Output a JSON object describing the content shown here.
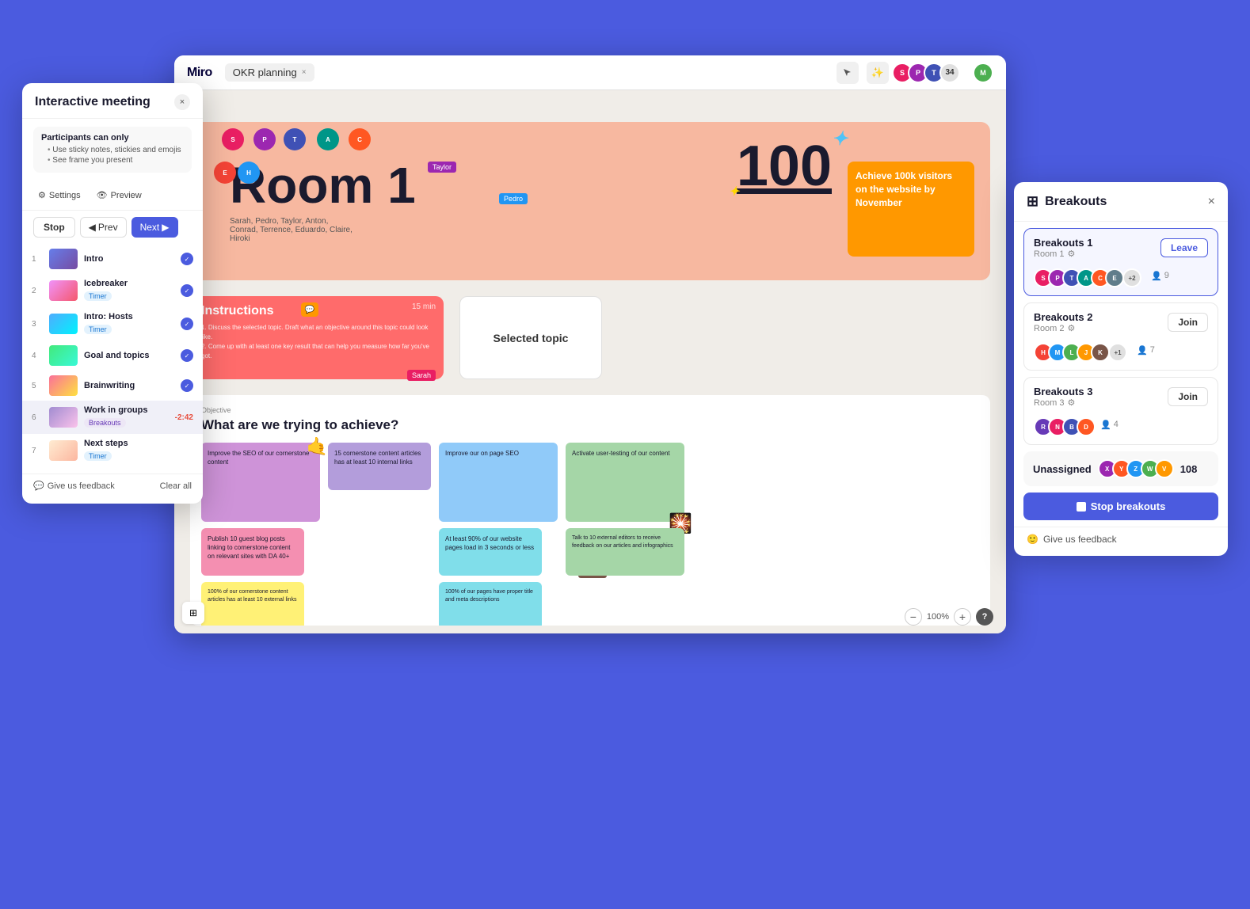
{
  "app": {
    "title": "Miro",
    "tab_label": "OKR planning",
    "canvas_room_label": "Room 1"
  },
  "header": {
    "avatars": [
      {
        "color": "c1",
        "initials": "S"
      },
      {
        "color": "c2",
        "initials": "P"
      },
      {
        "color": "c3",
        "initials": "T"
      }
    ],
    "participant_count": "34"
  },
  "left_panel": {
    "title": "Interactive meeting",
    "participants_box_title": "Participants can only",
    "participants_rules": [
      "Use sticky notes, stickies and emojis",
      "See frame you present"
    ],
    "settings_label": "Settings",
    "preview_label": "Preview",
    "stop_label": "Stop",
    "prev_label": "Prev",
    "next_label": "Next",
    "agenda_items": [
      {
        "num": "1",
        "label": "Intro",
        "has_check": true
      },
      {
        "num": "2",
        "label": "Icebreaker",
        "has_check": true,
        "badge": "Timer",
        "badge_type": "timer"
      },
      {
        "num": "3",
        "label": "Intro: Hosts",
        "has_check": true,
        "badge": "Timer",
        "badge_type": "timer"
      },
      {
        "num": "4",
        "label": "Goal and topics",
        "has_check": true
      },
      {
        "num": "5",
        "label": "Brainwriting",
        "has_check": true
      },
      {
        "num": "6",
        "label": "Work in groups",
        "time": "-2:42",
        "badge": "Breakouts",
        "badge_type": "breakout"
      },
      {
        "num": "7",
        "label": "Next steps",
        "badge": "Timer",
        "badge_type": "timer"
      }
    ],
    "feedback_label": "Give us feedback",
    "clear_label": "Clear all"
  },
  "canvas": {
    "room1_title": "Room 1",
    "room1_subtitle": "Sarah, Pedro, Taylor, Anton, Conrad, Terrence, Eduardo, Claire, Hiroki",
    "goal_card_text": "Achieve 100k visitors on the website by November",
    "number_100": "100",
    "instructions_title": "Instructions",
    "instructions_timer": "15 min",
    "instructions_text": "1. Discuss the selected topic. Draft what an objective around this topic could look like.\n2. Come up with at least one key result that can help you measure how far you've got.",
    "selected_topic_label": "Selected topic",
    "objective_label": "Objective",
    "objective_title": "What are we trying to achieve?",
    "sticky_notes": [
      {
        "color": "purple",
        "text": "Improve the SEO of our cornerstone content"
      },
      {
        "color": "blue",
        "text": "Improve our on page SEO"
      },
      {
        "color": "green",
        "text": "Activate user-testing of our content"
      },
      {
        "color": "pink",
        "text": "Publish 10 guest blog posts linking to cornerstone content on relevant sites with DA 40+"
      },
      {
        "color": "light-purple",
        "text": "15 cornerstone content articles has at least 10 internal links"
      },
      {
        "color": "light-blue",
        "text": "100% of our pages have proper title and meta descriptions"
      },
      {
        "color": "green",
        "text": "Talk to 10 external editors to receive feedback on our articles and infographics"
      },
      {
        "color": "yellow",
        "text": "100% of our cornerstone content articles has at least 10 external links"
      }
    ],
    "cursors": [
      {
        "name": "Sarah",
        "color": "#e91e63"
      },
      {
        "name": "Pedro",
        "color": "#3f51b5"
      },
      {
        "name": "Taylor",
        "color": "#9c27b0"
      },
      {
        "name": "Eduardo",
        "color": "#4CAF50"
      },
      {
        "name": "Anton",
        "color": "#FF5722"
      },
      {
        "name": "Conrad",
        "color": "#009688"
      },
      {
        "name": "Claire",
        "color": "#795548"
      },
      {
        "name": "Hiroki",
        "color": "#607D8B"
      },
      {
        "name": "Terrence",
        "color": "#333"
      }
    ],
    "zoom_level": "100%"
  },
  "breakouts_panel": {
    "title": "Breakouts",
    "rooms": [
      {
        "name": "Breakouts 1",
        "sub": "Room 1",
        "action": "Leave",
        "is_active": true,
        "count": 9,
        "avatars": [
          "c1",
          "c2",
          "c3",
          "c4",
          "c5",
          "c6"
        ]
      },
      {
        "name": "Breakouts 2",
        "sub": "Room 2",
        "action": "Join",
        "is_active": false,
        "count": 7,
        "avatars": [
          "c7",
          "c8",
          "c9",
          "ca",
          "cb"
        ]
      },
      {
        "name": "Breakouts 3",
        "sub": "Room 3",
        "action": "Join",
        "is_active": false,
        "count": 4,
        "avatars": [
          "cc",
          "c1",
          "c3",
          "c5"
        ]
      }
    ],
    "unassigned_label": "Unassigned",
    "unassigned_count": "108",
    "stop_breakouts_label": "Stop breakouts",
    "feedback_label": "Give us feedback"
  }
}
